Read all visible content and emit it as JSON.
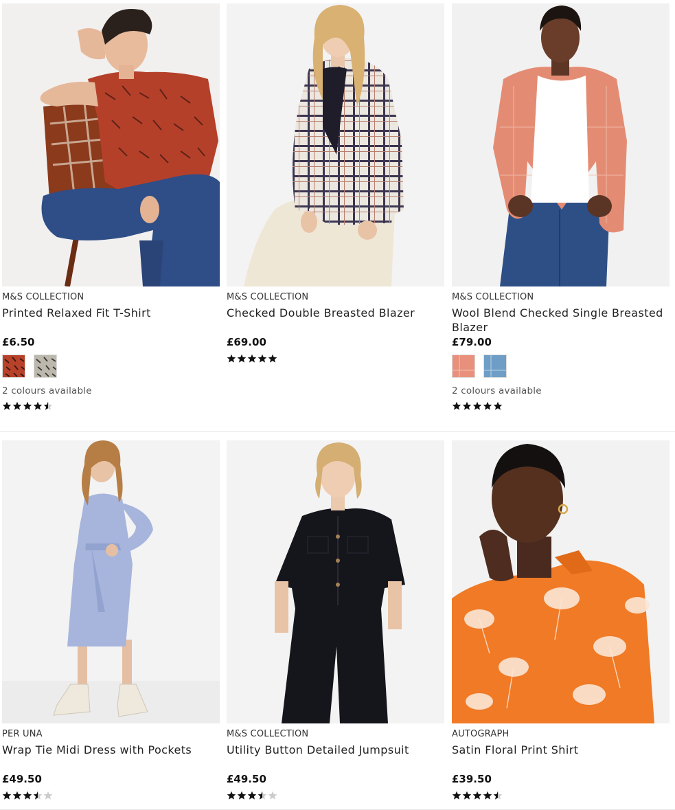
{
  "products": [
    {
      "brand": "M&S COLLECTION",
      "name": "Printed Relaxed Fit T-Shirt",
      "price": "£6.50",
      "swatches": [
        "#b8412a",
        "#8a8478"
      ],
      "colours_text": "2 colours available",
      "rating": 4.5
    },
    {
      "brand": "M&S COLLECTION",
      "name": "Checked Double Breasted Blazer",
      "price": "£69.00",
      "swatches": [],
      "colours_text": "",
      "rating": 5
    },
    {
      "brand": "M&S COLLECTION",
      "name": "Wool Blend Checked Single Breasted Blazer",
      "price": "£79.00",
      "swatches": [
        "#e8907c",
        "#6e9ec6"
      ],
      "colours_text": "2 colours available",
      "rating": 5
    },
    {
      "brand": "PER UNA",
      "name": "Wrap Tie Midi Dress with Pockets",
      "price": "£49.50",
      "swatches": [],
      "colours_text": "",
      "rating": 3.5
    },
    {
      "brand": "M&S COLLECTION",
      "name": "Utility Button Detailed Jumpsuit",
      "price": "£49.50",
      "swatches": [],
      "colours_text": "",
      "rating": 3.5
    },
    {
      "brand": "AUTOGRAPH",
      "name": "Satin Floral Print Shirt",
      "price": "£39.50",
      "swatches": [],
      "colours_text": "",
      "rating": 4.5
    }
  ],
  "colors": {
    "star_filled": "#111111",
    "star_empty": "#cccccc",
    "image_bg": "#f2f2f2"
  }
}
